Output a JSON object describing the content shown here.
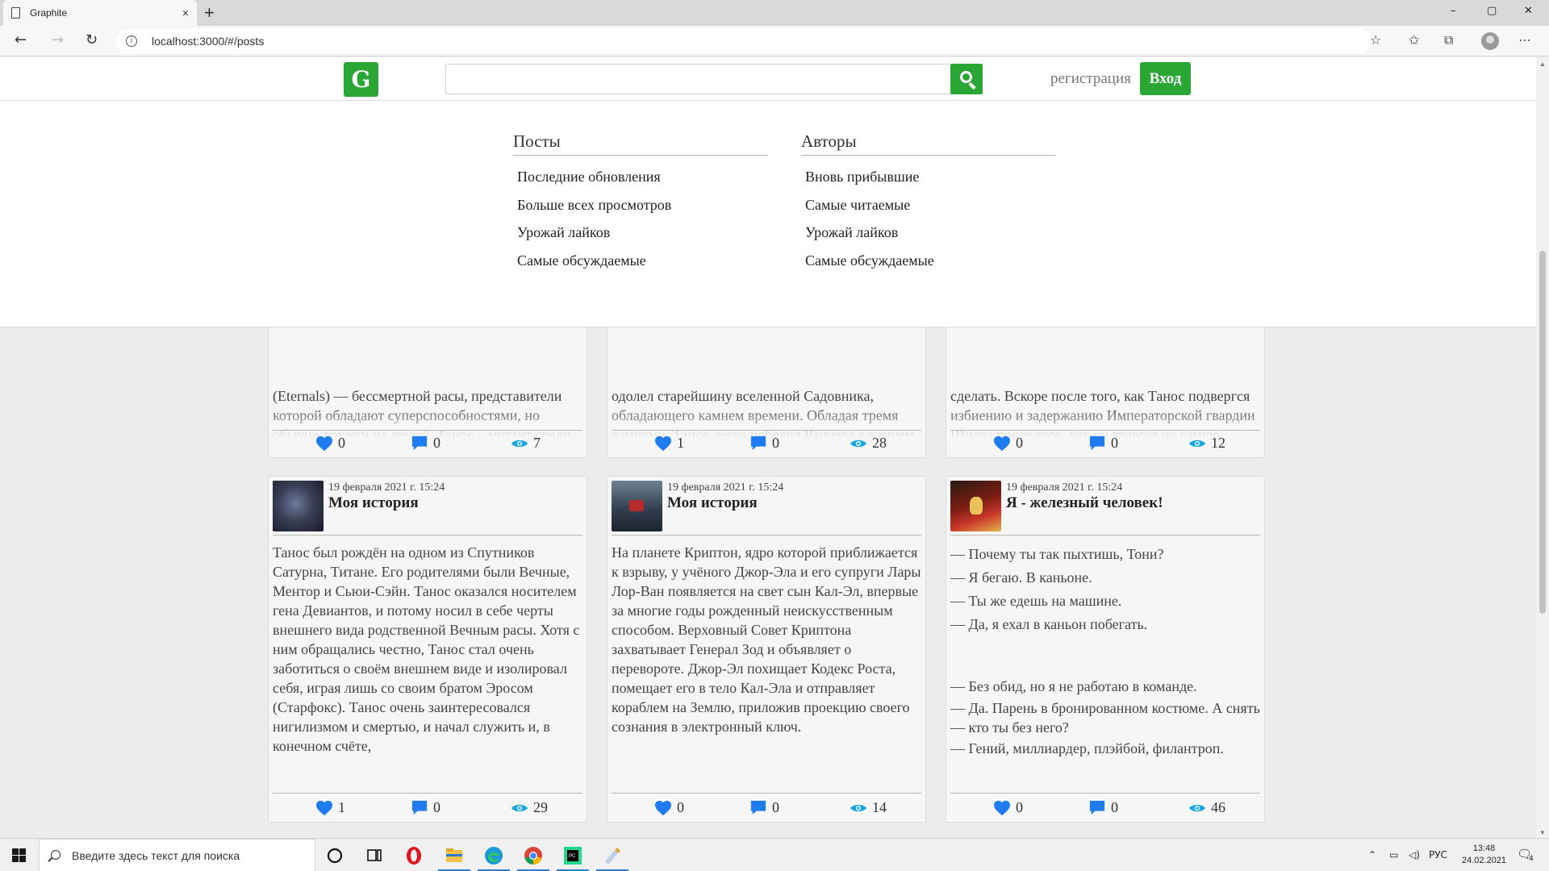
{
  "browser": {
    "tab_title": "Graphite",
    "tab_close": "×",
    "new_tab": "+",
    "url": "localhost:3000/#/posts",
    "window_controls": {
      "minimize": "–",
      "maximize": "▢",
      "close": "✕"
    },
    "icons": [
      "back-icon",
      "forward-icon",
      "refresh-icon",
      "info-icon",
      "favorite-add-icon",
      "favorites-icon",
      "collections-icon",
      "profile-icon",
      "more-icon"
    ]
  },
  "header": {
    "logo": "G",
    "search": {
      "value": "",
      "placeholder": ""
    },
    "register_label": "регистрация",
    "login_label": "Вход"
  },
  "menu": {
    "posts": {
      "title": "Посты",
      "items": [
        "Последние обновления",
        "Больше всех просмотров",
        "Урожай лайков",
        "Самые обсуждаемые"
      ]
    },
    "authors": {
      "title": "Авторы",
      "items": [
        "Вновь прибывшие",
        "Самые читаемые",
        "Урожай лайков",
        "Самые обсуждаемые"
      ]
    }
  },
  "top_cards": [
    {
      "body": "(Eternals) — бессмертной расы, представители которой обладают суперспособностями, но обычно похожи на людей. Танос – мутант среди Вечных,",
      "likes": "0",
      "comments": "0",
      "views": "7"
    },
    {
      "body": "одолел старейшину вселенной Садовника, обладающего камнем времени. Обладая тремя камнями, Танос легко победил Раннера с камнем пространства, выменяв у",
      "likes": "1",
      "comments": "0",
      "views": "28"
    },
    {
      "body": "сделать. Вскоре после того, как Танос подвергся избиению и задержанию Императорской гвардии Шиара после того, как он вторгся на самую планету станции",
      "likes": "0",
      "comments": "0",
      "views": "12"
    }
  ],
  "cards": [
    {
      "date": "19 февраля 2021 г. 15:24",
      "title": "Моя история",
      "avatar": "thanos-avatar",
      "body": "Танос был рождён на одном из Спутников Сатурна, Титане. Его родителями были Вечные, Ментор и Сьюи-Сэйн. Танос оказался носителем гена Девиантов, и потому носил в себе черты внешнего вида родственной Вечным расы. Хотя с ним обращались честно, Танос стал очень заботиться о своём внешнем виде и изолировал себя, играя лишь со своим братом Эросом (Старфокс). Танос очень заинтересовался нигилизмом и смертью, и начал служить и, в конечном счёте,",
      "likes": "1",
      "comments": "0",
      "views": "29"
    },
    {
      "date": "19 февраля 2021 г. 15:24",
      "title": "Моя история",
      "avatar": "superman-avatar",
      "body": "На планете Криптон, ядро которой приближается к взрыву, у учёного Джор-Эла и его супруги Лары Лор-Ван появляется на свет сын Кал-Эл, впервые за многие годы рожденный неискусственным способом. Верховный Совет Криптона захватывает Генерал Зод и объявляет о перевороте. Джор-Эл похищает Кодекс Роста, помещает его в тело Кал-Эла и отправляет кораблем на Землю, приложив проекцию своего сознания в электронный ключ.",
      "likes": "0",
      "comments": "0",
      "views": "14"
    },
    {
      "date": "19 февраля 2021 г. 15:24",
      "title": "Я - железный человек!",
      "avatar": "ironman-avatar",
      "lines_a": [
        "— Почему ты так пыхтишь, Тони?",
        "— Я бегаю. В каньоне.",
        "— Ты же едешь на машине.",
        "— Да, я ехал в каньон побегать."
      ],
      "lines_b": [
        "— Без обид, но я не работаю в команде.",
        "— Да. Парень в бронированном костюме. А снять — кто ты без него?",
        "— Гений, миллиардер, плэйбой, филантроп."
      ],
      "likes": "0",
      "comments": "0",
      "views": "46"
    }
  ],
  "colors": {
    "brand_green": "#2aa635",
    "like_blue": "#1e7bf0",
    "view_cyan": "#1aa7e6"
  },
  "taskbar": {
    "search_placeholder": "Введите здесь текст для поиска",
    "language": "РУС",
    "time": "13:48",
    "date": "24.02.2021",
    "notifications": "4",
    "apps": [
      "task-view-icon",
      "opera-icon",
      "file-explorer-icon",
      "edge-icon",
      "chrome-icon",
      "pycharm-icon",
      "paint-icon"
    ]
  }
}
